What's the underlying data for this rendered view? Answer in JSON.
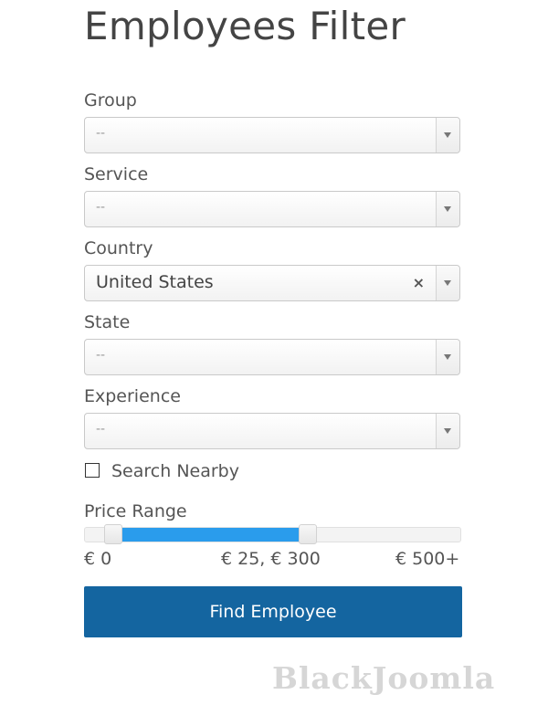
{
  "title": "Employees Filter",
  "fields": [
    {
      "label": "Group",
      "value": "--"
    },
    {
      "label": "Service",
      "value": "--"
    },
    {
      "label": "Country",
      "value": "United States",
      "clear_icon": "close-icon"
    },
    {
      "label": "State",
      "value": "--"
    },
    {
      "label": "Experience",
      "value": "--"
    }
  ],
  "search_nearby": {
    "label": "Search Nearby",
    "checked": false
  },
  "price_range": {
    "label": "Price Range",
    "min": 0,
    "max": 500,
    "selected_low": 25,
    "selected_high": 300,
    "min_label": "€ 0",
    "current_label": "€ 25, € 300",
    "max_label": "€ 500+",
    "range_color": "#2a9cec"
  },
  "submit": {
    "label": "Find Employee",
    "color": "#1465a0"
  },
  "watermark": "BlackJoomla"
}
